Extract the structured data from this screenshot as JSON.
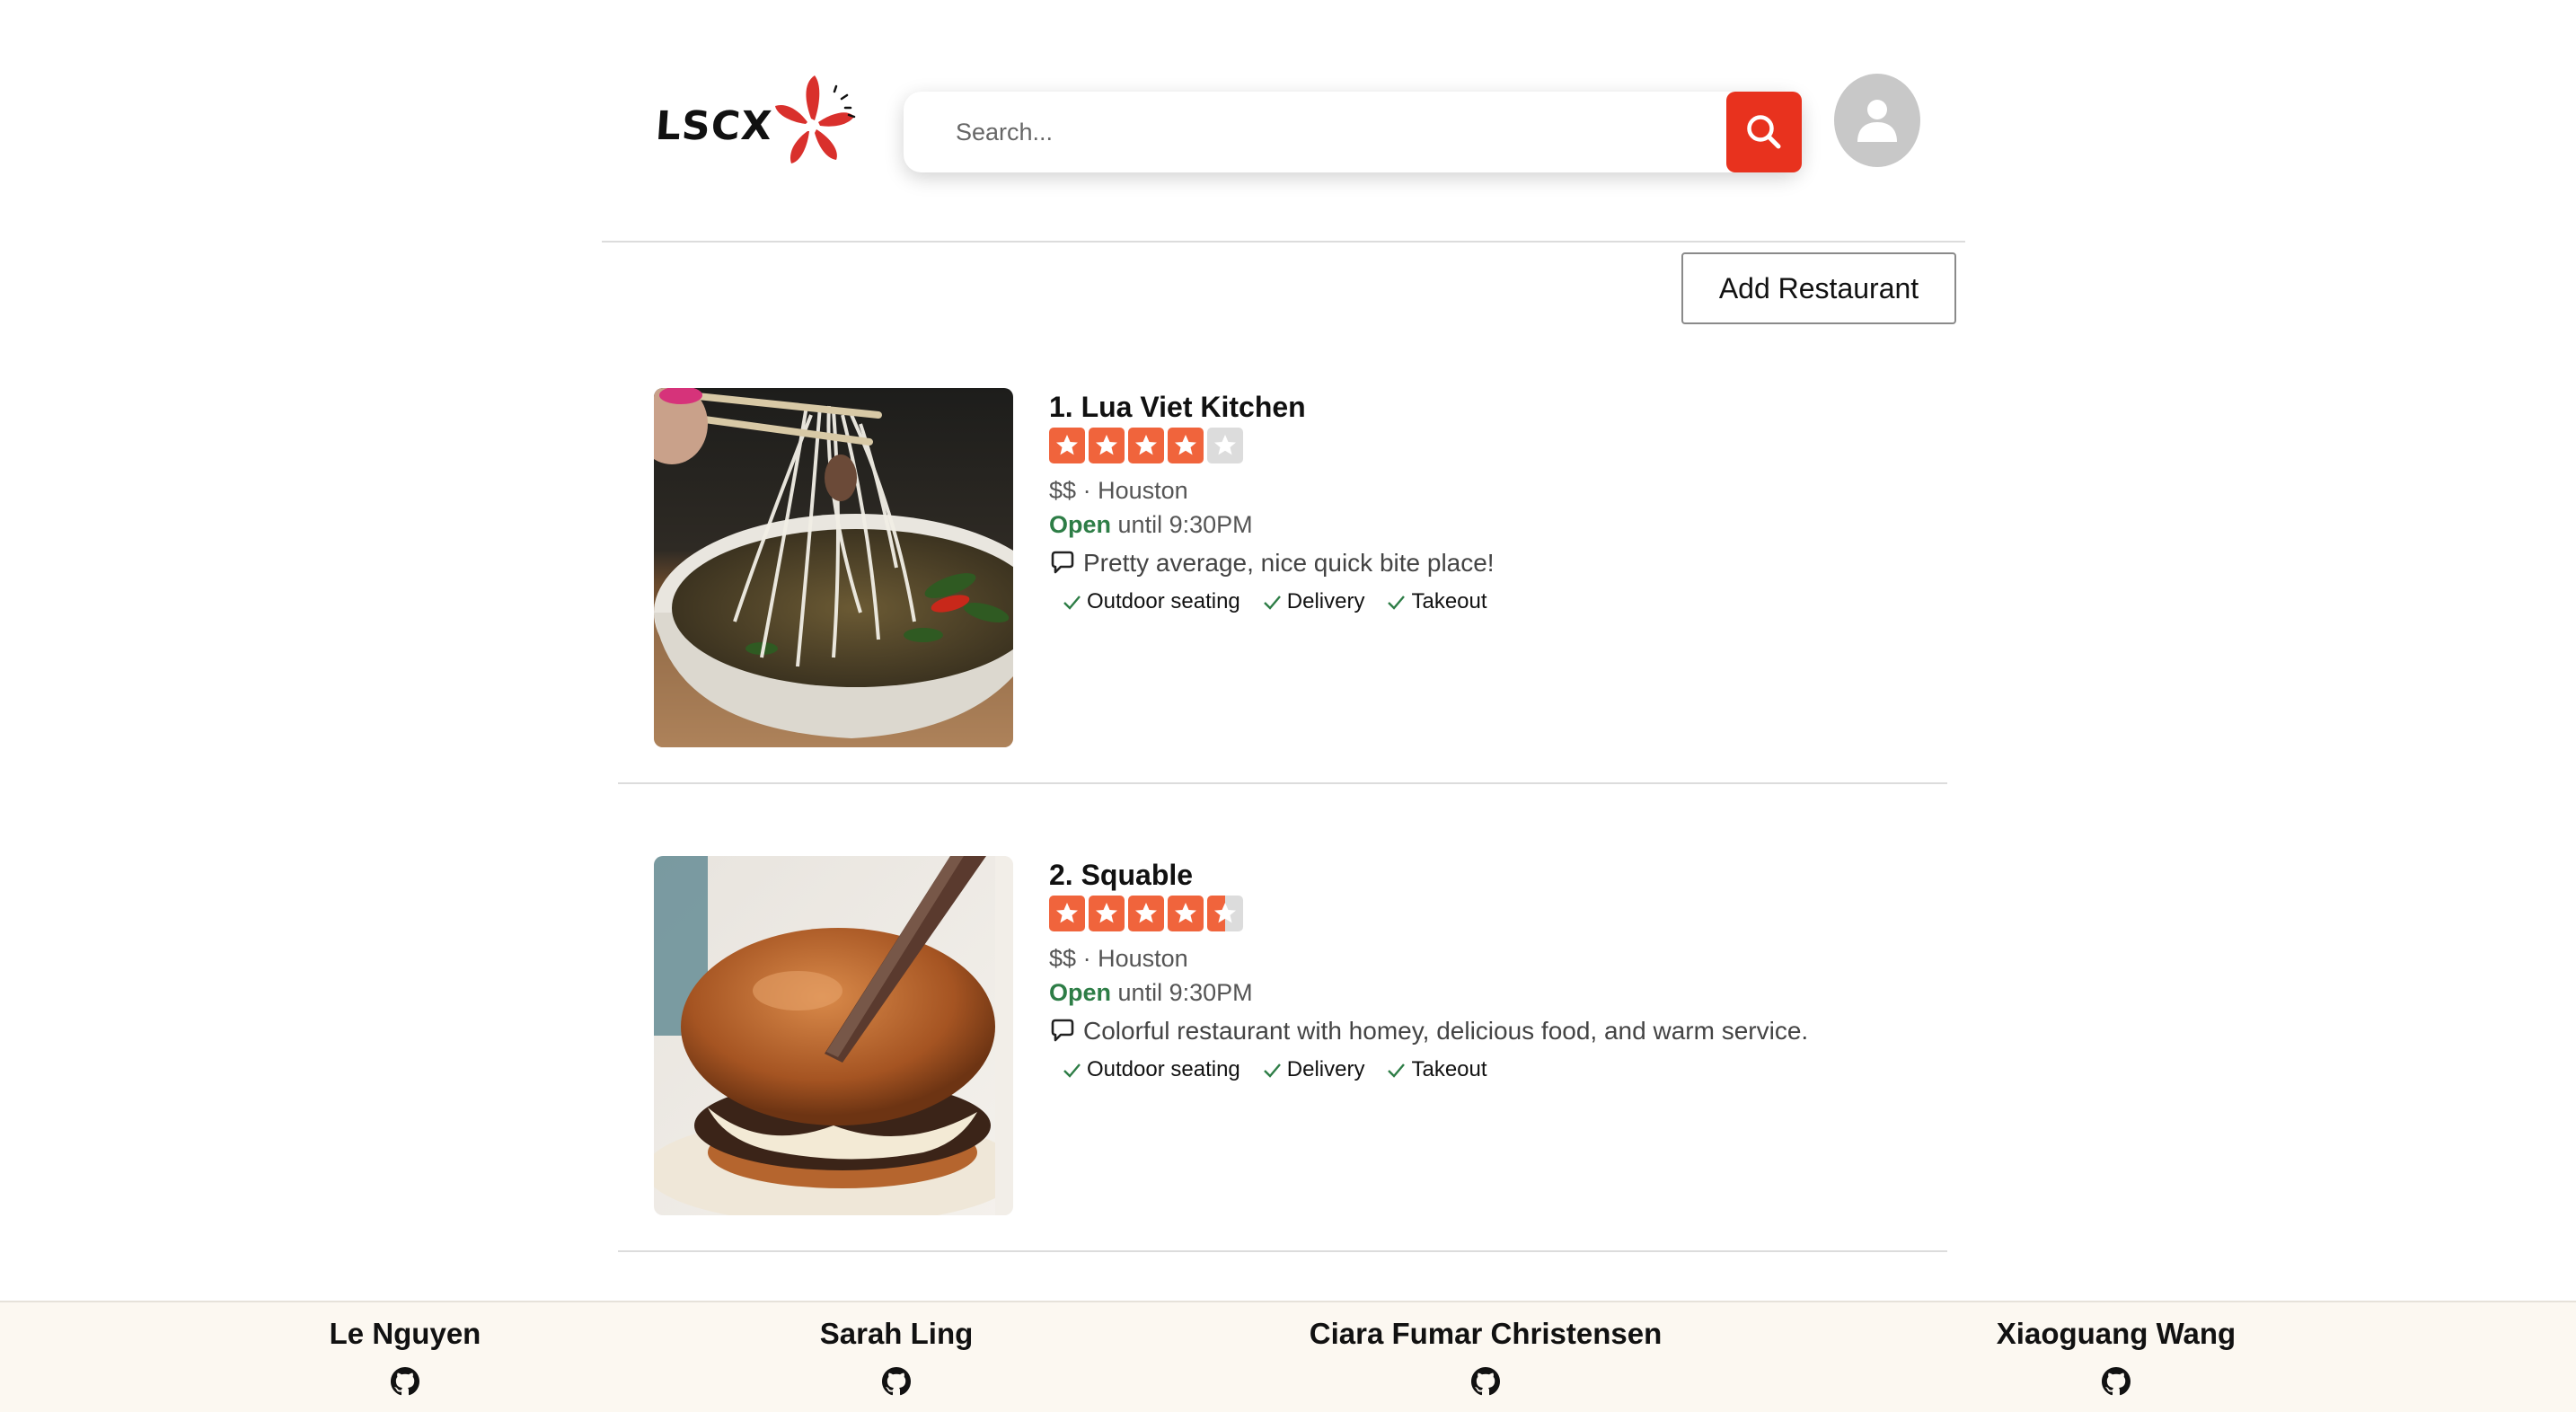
{
  "header": {
    "logo_text": "LSCX",
    "search": {
      "placeholder": "Search..."
    },
    "add_button_label": "Add Restaurant"
  },
  "restaurants": [
    {
      "index_title": "1. Lua Viet Kitchen",
      "rating": 4,
      "price": "$$",
      "separator": "·",
      "city": "Houston",
      "open_label": "Open",
      "hours": "until 9:30PM",
      "snippet": "Pretty average, nice quick bite place!",
      "features": [
        "Outdoor seating",
        "Delivery",
        "Takeout"
      ],
      "photo": "pho-noodle-soup"
    },
    {
      "index_title": "2. Squable",
      "rating": 4.5,
      "price": "$$",
      "separator": "·",
      "city": "Houston",
      "open_label": "Open",
      "hours": "until 9:30PM",
      "snippet": "Colorful restaurant with homey, delicious food, and warm service.",
      "features": [
        "Outdoor seating",
        "Delivery",
        "Takeout"
      ],
      "photo": "burger-with-knife"
    }
  ],
  "footer": {
    "authors": [
      {
        "name": "Le Nguyen",
        "icon": "github-icon"
      },
      {
        "name": "Sarah Ling",
        "icon": "github-icon"
      },
      {
        "name": "Ciara Fumar Christensen",
        "icon": "github-icon"
      },
      {
        "name": "Xiaoguang Wang",
        "icon": "github-icon"
      }
    ]
  },
  "colors": {
    "accent": "#e8321e",
    "star_fill": "#f0643c",
    "star_empty": "#dcdcdc",
    "open_green": "#2d7d46",
    "footer_bg": "#fcf8f1"
  }
}
